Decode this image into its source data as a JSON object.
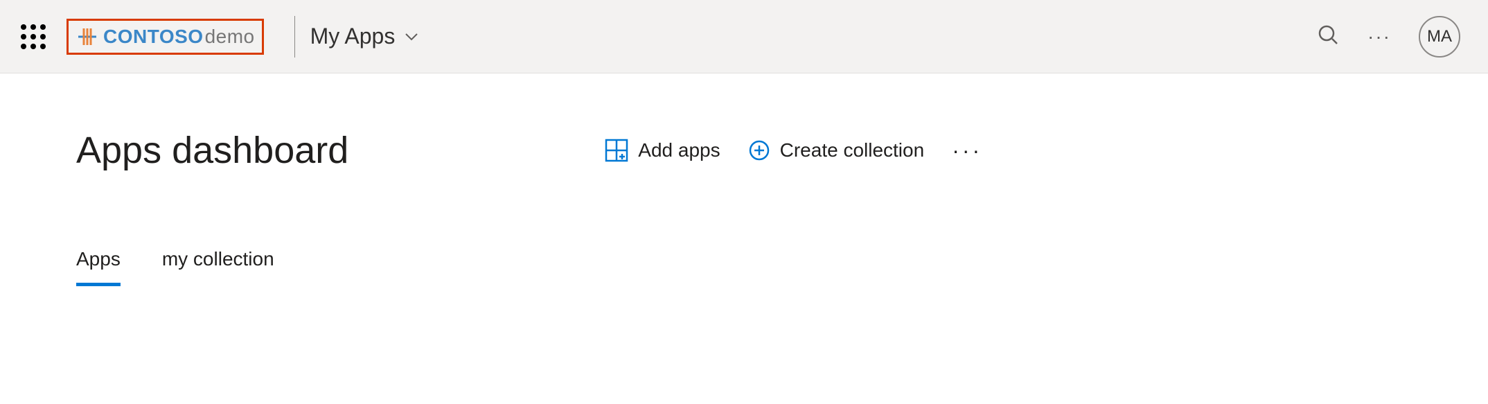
{
  "header": {
    "brand_main": "CONTOSO",
    "brand_sub": "demo",
    "app_switcher_label": "My Apps",
    "avatar_initials": "MA"
  },
  "page": {
    "title": "Apps dashboard",
    "add_apps_label": "Add apps",
    "create_collection_label": "Create collection"
  },
  "tabs": {
    "tab1": "Apps",
    "tab2": "my collection"
  }
}
